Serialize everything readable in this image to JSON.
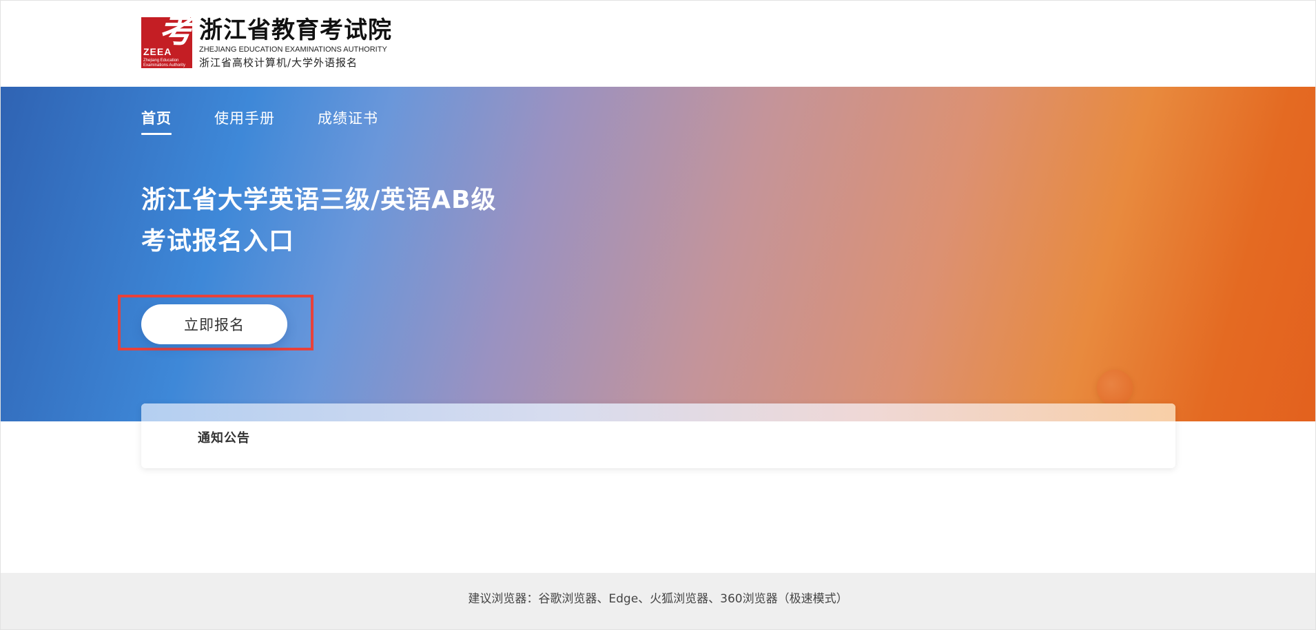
{
  "header": {
    "logo": {
      "mark_char": "考",
      "mark_abbr": "ZEEA",
      "mark_sub_line1": "Zhejiang Education",
      "mark_sub_line2": "Examinations Authority",
      "title": "浙江省教育考试院",
      "english": "ZHEJIANG EDUCATION EXAMINATIONS AUTHORITY",
      "subtitle": "浙江省高校计算机/大学外语报名"
    }
  },
  "nav": {
    "items": [
      {
        "label": "首页",
        "active": true
      },
      {
        "label": "使用手册",
        "active": false
      },
      {
        "label": "成绩证书",
        "active": false
      }
    ]
  },
  "hero": {
    "title_line1": "浙江省大学英语三级/英语AB级",
    "title_line2": "考试报名入口",
    "cta_label": "立即报名"
  },
  "notice": {
    "title": "通知公告"
  },
  "footer": {
    "text": "建议浏览器：谷歌浏览器、Edge、火狐浏览器、360浏览器（极速模式）"
  },
  "colors": {
    "brand_red": "#c41e24",
    "banner_blue": "#2f63b3",
    "banner_orange": "#e3611e",
    "highlight_red": "#e8413a",
    "footer_bg": "#efefef"
  }
}
